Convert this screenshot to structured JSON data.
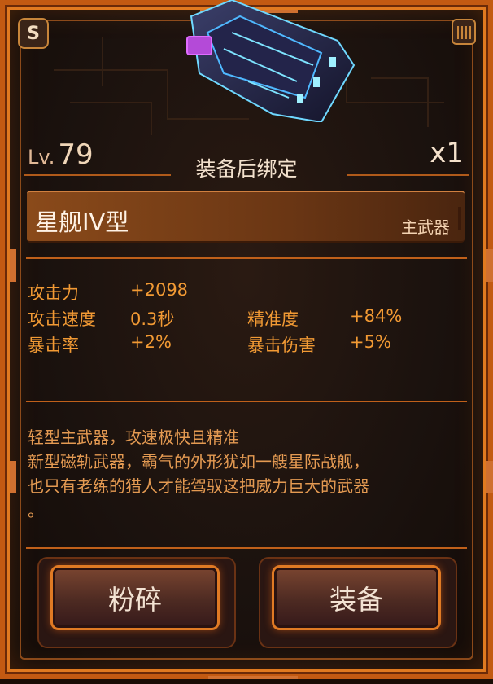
{
  "badge_letter": "S",
  "item": {
    "level_prefix": "Lv.",
    "level": "79",
    "quantity": "x1",
    "bind_text": "装备后绑定",
    "name": "星舰IV型",
    "type": "主武器"
  },
  "stats": {
    "attack_label": "攻击力",
    "attack_value": "+2098",
    "speed_label": "攻击速度",
    "speed_value": "0.3秒",
    "accuracy_label": "精准度",
    "accuracy_value": "+84%",
    "crit_rate_label": "暴击率",
    "crit_rate_value": "+2%",
    "crit_dmg_label": "暴击伤害",
    "crit_dmg_value": "+5%"
  },
  "description": {
    "line1": "轻型主武器，攻速极快且精准",
    "line2": "新型磁轨武器，霸气的外形犹如一艘星际战舰，",
    "line3": "也只有老练的猎人才能驾驭这把威力巨大的武器",
    "line4": "。"
  },
  "buttons": {
    "dismantle": "粉碎",
    "equip": "装备"
  },
  "colors": {
    "frame": "#c25a12",
    "stat_text": "#f29a34",
    "desc_text": "#e49a52"
  }
}
